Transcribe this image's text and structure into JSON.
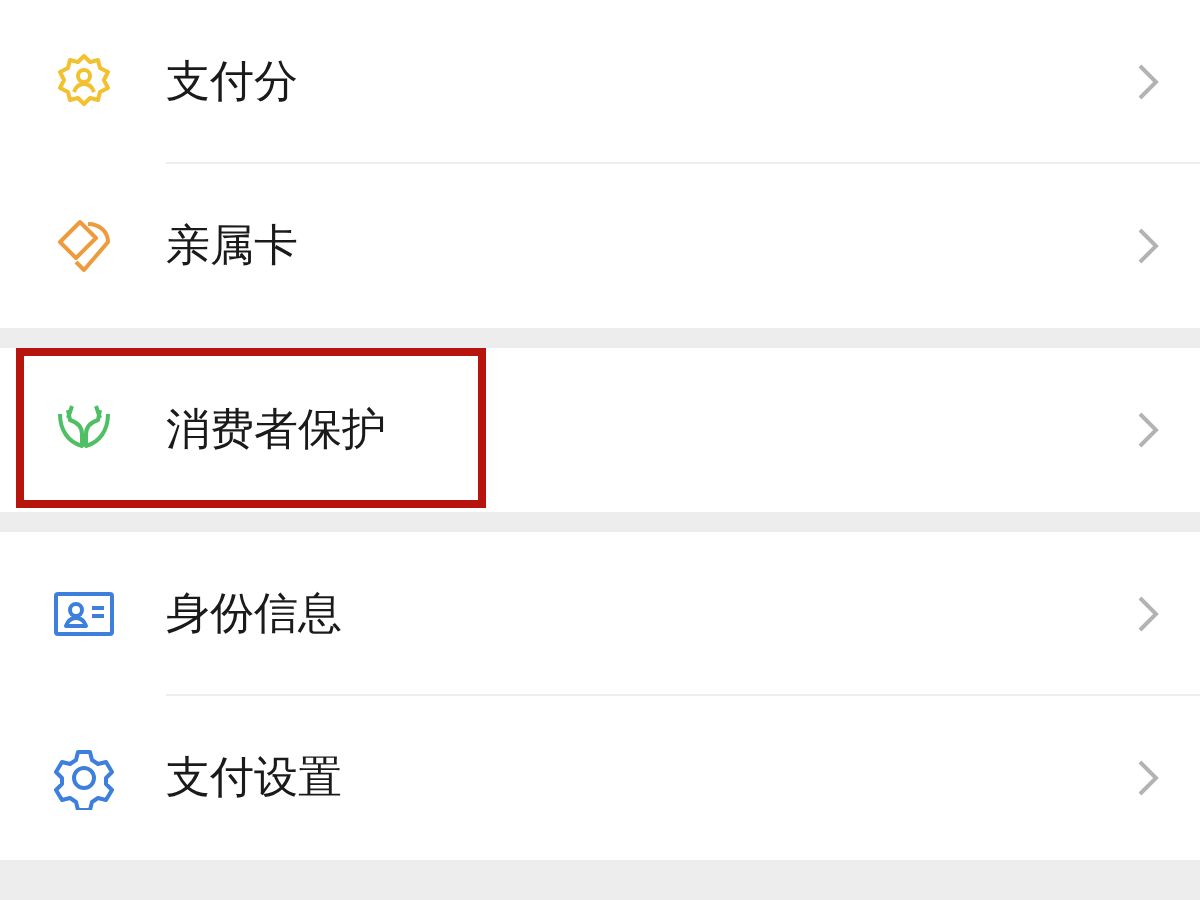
{
  "groups": [
    {
      "items": [
        {
          "label": "支付分",
          "color": "#f3c12f",
          "highlighted": false
        },
        {
          "label": "亲属卡",
          "color": "#ee9b3d",
          "highlighted": false
        }
      ]
    },
    {
      "items": [
        {
          "label": "消费者保护",
          "color": "#4fbf64",
          "highlighted": true
        }
      ]
    },
    {
      "items": [
        {
          "label": "身份信息",
          "color": "#3d80dc",
          "highlighted": false
        },
        {
          "label": "支付设置",
          "color": "#3d80dc",
          "highlighted": false
        }
      ]
    }
  ]
}
